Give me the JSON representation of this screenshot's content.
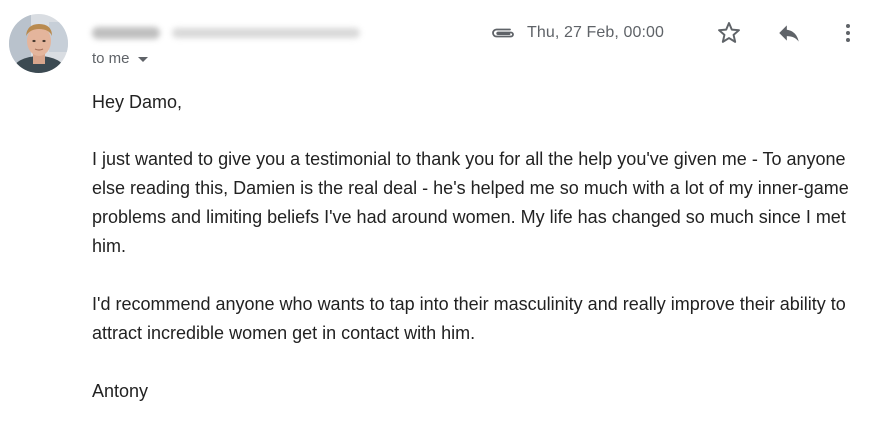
{
  "header": {
    "date": "Thu, 27 Feb, 00:00",
    "to_label": "to me"
  },
  "icons": {
    "attachment": "paperclip-icon",
    "star": "star-outline-icon",
    "reply": "reply-icon",
    "more": "more-vert-icon",
    "caret": "caret-down-icon"
  },
  "colors": {
    "text_primary": "#222222",
    "text_secondary": "#5f6368"
  },
  "message": {
    "greeting": "Hey Damo,",
    "paragraph_1": "I just wanted to give you a testimonial to thank you for all the help you've given me - To anyone else reading this, Damien is the real deal - he's helped me so much with a lot of my inner-game problems and limiting beliefs I've had around women. My life has changed so much since I met him.",
    "paragraph_2": "I'd recommend anyone who wants to tap into their masculinity and really improve their ability to attract incredible women get in contact with him.",
    "signature": "Antony"
  }
}
